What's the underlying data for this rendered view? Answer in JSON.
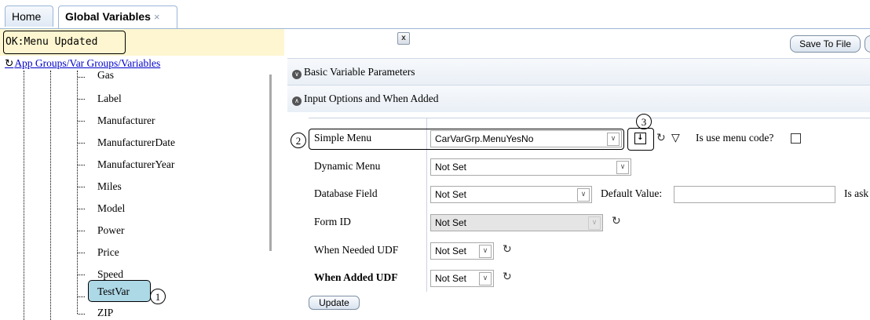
{
  "tabs": [
    {
      "label": "Home"
    },
    {
      "label": "Global Variables",
      "close": "×"
    }
  ],
  "status": {
    "message": "OK:Menu Updated",
    "close": "x"
  },
  "toolbar": {
    "save_label": "Save To File"
  },
  "tree": {
    "root_label": "App Groups/Var Groups/Variables",
    "items": [
      "Gas",
      "Label",
      "Manufacturer",
      "ManufacturerDate",
      "ManufacturerYear",
      "Miles",
      "Model",
      "Power",
      "Price",
      "Speed",
      "TestVar",
      "ZIP"
    ],
    "selected": "TestVar"
  },
  "accordion": {
    "basic": "Basic Variable Parameters",
    "input": "Input Options and When Added"
  },
  "form": {
    "simple_menu": {
      "label": "Simple Menu",
      "value": "CarVarGrp.MenuYesNo",
      "use_code_label": "Is use menu code?"
    },
    "dynamic_menu": {
      "label": "Dynamic Menu",
      "value": "Not Set"
    },
    "database_field": {
      "label": "Database Field",
      "value": "Not Set",
      "default_label": "Default Value:",
      "trailing": "Is ask"
    },
    "form_id": {
      "label": "Form ID",
      "value": "Not Set"
    },
    "when_needed": {
      "label": "When Needed UDF",
      "value": "Not Set"
    },
    "when_added": {
      "label": "When Added UDF",
      "value": "Not Set"
    },
    "update_label": "Update"
  },
  "callouts": [
    "1",
    "2",
    "3"
  ]
}
